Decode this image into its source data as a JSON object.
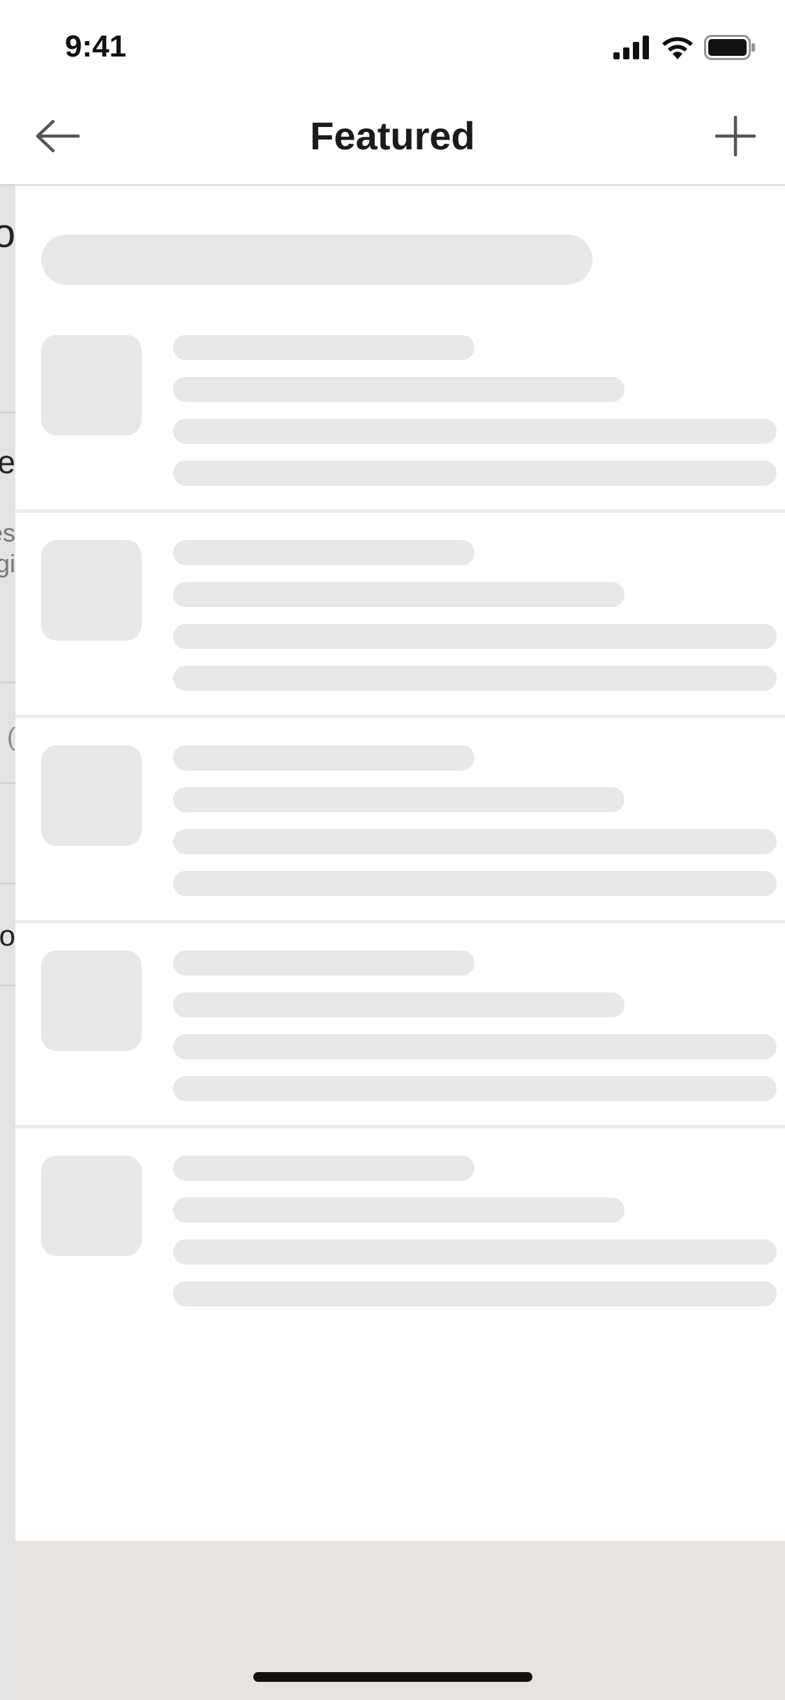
{
  "status_bar": {
    "time": "9:41",
    "icons": [
      "signal-icon",
      "wifi-icon",
      "battery-icon"
    ]
  },
  "nav": {
    "title": "Featured",
    "back_icon": "arrow-left-icon",
    "add_icon": "plus-icon"
  },
  "background_page": {
    "fragments": [
      "o",
      "e",
      "es",
      "gi",
      "(",
      "no"
    ]
  },
  "skeleton": {
    "rows": 5
  },
  "colors": {
    "skeleton": "#e8e8e8",
    "bottom_area": "#e7e3df",
    "title": "#1b1b1b"
  }
}
